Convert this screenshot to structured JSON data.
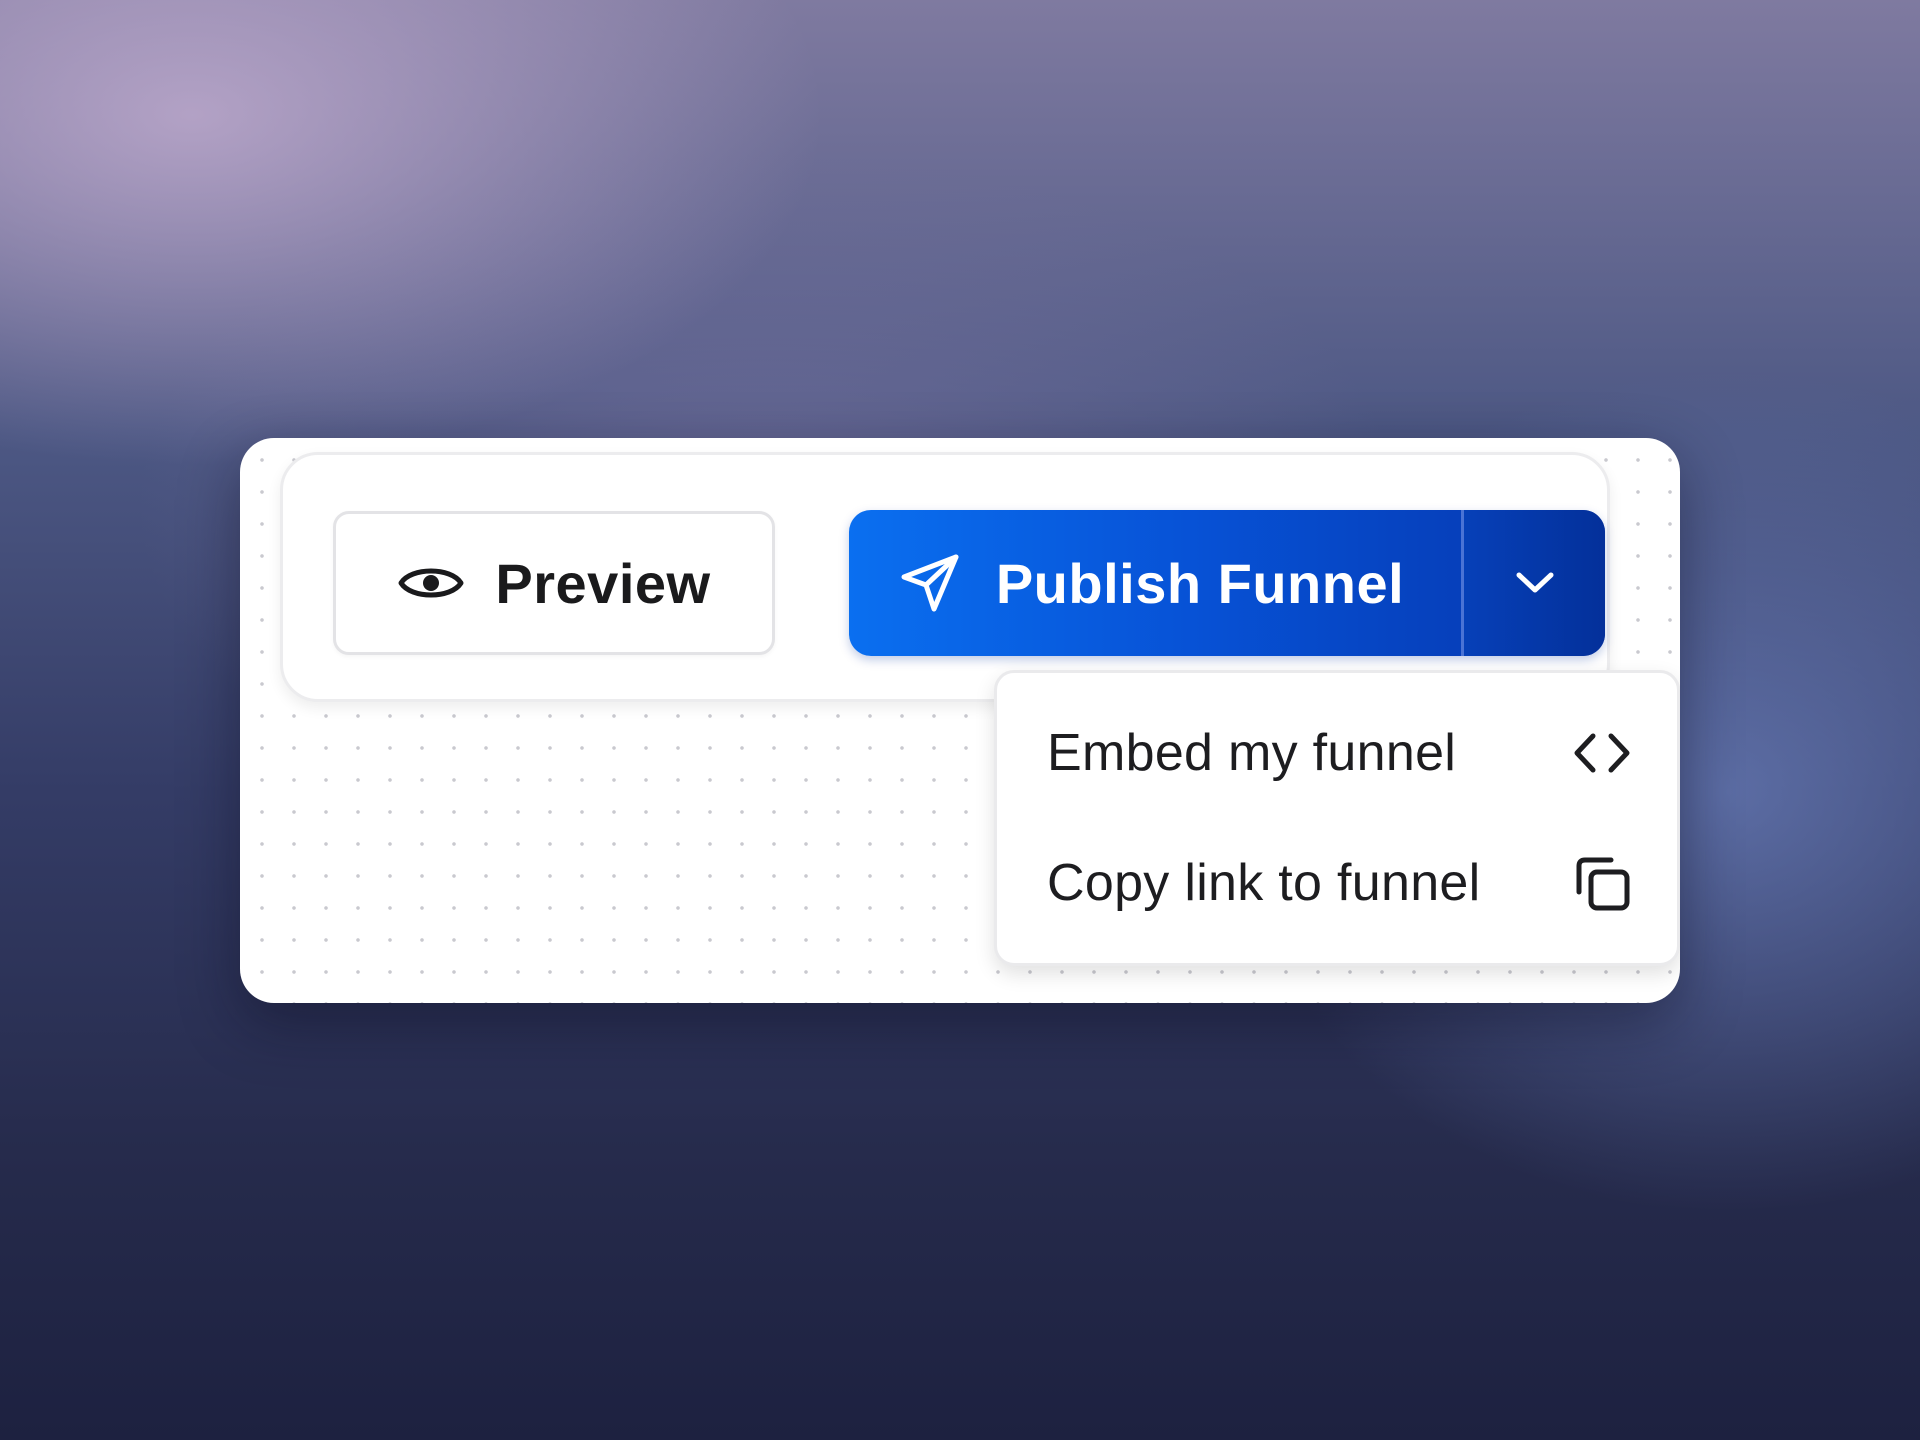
{
  "toolbar": {
    "preview_label": "Preview",
    "preview_icon": "eye-icon",
    "publish_label": "Publish Funnel",
    "publish_icon": "send-icon",
    "dropdown_icon": "chevron-down-icon"
  },
  "dropdown": {
    "items": [
      {
        "label": "Embed my funnel",
        "icon": "code-icon"
      },
      {
        "label": "Copy link to funnel",
        "icon": "copy-icon"
      }
    ]
  },
  "colors": {
    "publish_gradient_start": "#0a6ff0",
    "publish_gradient_end": "#0536ad",
    "text_dark": "#1a1a1c",
    "card_background": "#ffffff"
  }
}
